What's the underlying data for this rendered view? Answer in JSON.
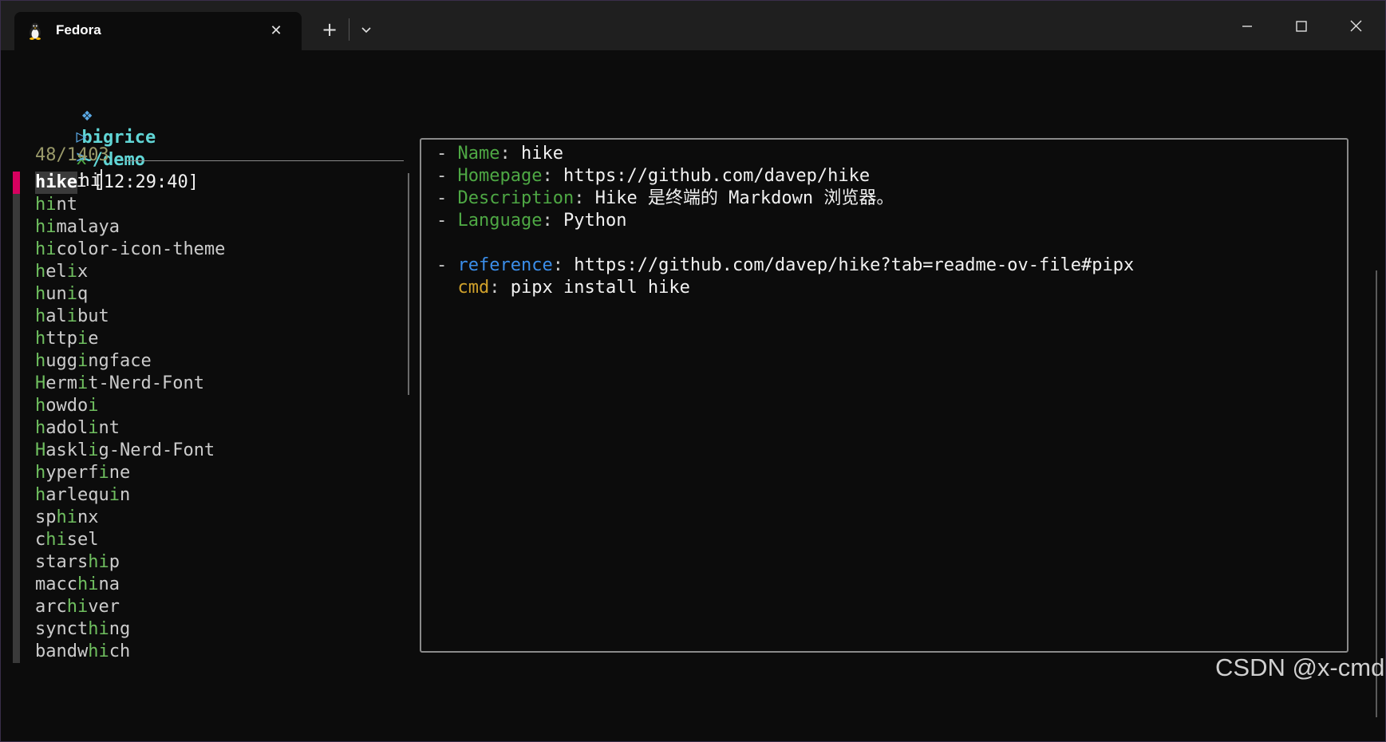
{
  "tab": {
    "title": "Fedora",
    "icon": "tux-penguin-icon"
  },
  "prompt": {
    "symbol": "❖",
    "user": "bigrice",
    "path": "~/demo",
    "time": "[12:29:40]",
    "cmd_arrow": "▷",
    "cmd_name": "x",
    "cmd_arg": "i",
    "query_prompt": ">",
    "query": "hi"
  },
  "counter": "48/1403",
  "results": [
    "hike",
    "hint",
    "himalaya",
    "hicolor-icon-theme",
    "helix",
    "huniq",
    "halibut",
    "httpie",
    "huggingface",
    "Hermit-Nerd-Font",
    "howdoi",
    "hadolint",
    "Hasklig-Nerd-Font",
    "hyperfine",
    "harlequin",
    "sphinx",
    "chisel",
    "starship",
    "macchina",
    "archiver",
    "syncthing",
    "bandwhich"
  ],
  "preview": {
    "name_key": "Name",
    "name_val": "hike",
    "homepage_key": "Homepage",
    "homepage_val": "https://github.com/davep/hike",
    "description_key": "Description",
    "description_val": "Hike 是终端的 Markdown 浏览器。",
    "language_key": "Language",
    "language_val": "Python",
    "reference_key": "reference",
    "reference_val": "https://github.com/davep/hike?tab=readme-ov-file#pipx",
    "cmd_key": "cmd",
    "cmd_val": "pipx install hike"
  },
  "watermark": "CSDN @x-cmd",
  "colors": {
    "background": "#0c0c0c",
    "prompt_cyan": "#61d6d6",
    "key_green": "#4ea844",
    "match_green": "#6fbf5f",
    "selected_marker": "#d7005f",
    "cmd_key_yellow": "#d0a12b",
    "reference_blue": "#3b8eea"
  }
}
